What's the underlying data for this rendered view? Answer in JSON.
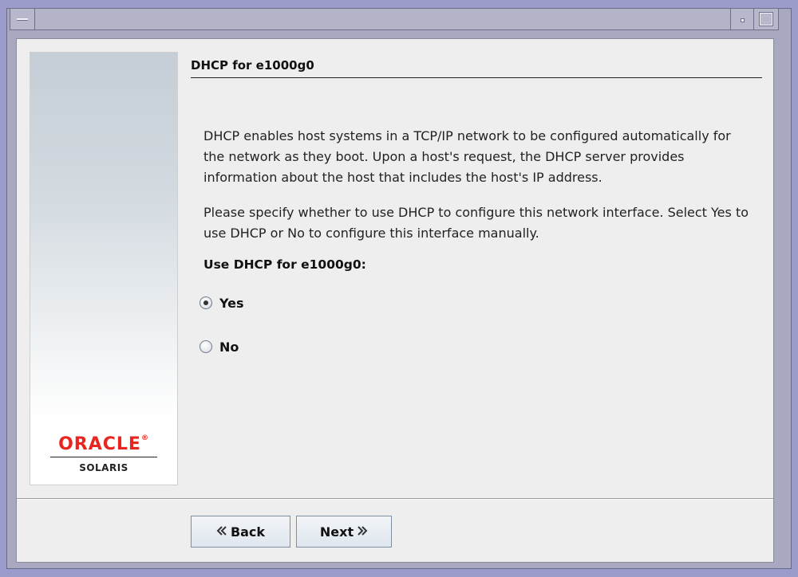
{
  "heading": "DHCP for e1000g0",
  "paragraph_1": "DHCP enables host systems in a TCP/IP network to be configured automatically for the network as they boot. Upon a host's request, the DHCP server provides information about the host that includes the host's IP address.",
  "paragraph_2": "Please specify whether to use DHCP to configure this network interface. Select Yes to use DHCP or No to configure this interface manually.",
  "question": "Use DHCP for e1000g0:",
  "options": [
    {
      "label": "Yes",
      "selected": true
    },
    {
      "label": "No",
      "selected": false
    }
  ],
  "logo": {
    "brand": "ORACLE",
    "mark": "®",
    "product": "SOLARIS",
    "brand_color": "#e8261f"
  },
  "buttons": {
    "back": "Back",
    "next": "Next"
  },
  "icons": {
    "window_menu": "window-menu-icon",
    "minimize": "minimize-icon",
    "maximize": "maximize-icon",
    "back": "chevron-left-double-icon",
    "next": "chevron-right-double-icon"
  }
}
